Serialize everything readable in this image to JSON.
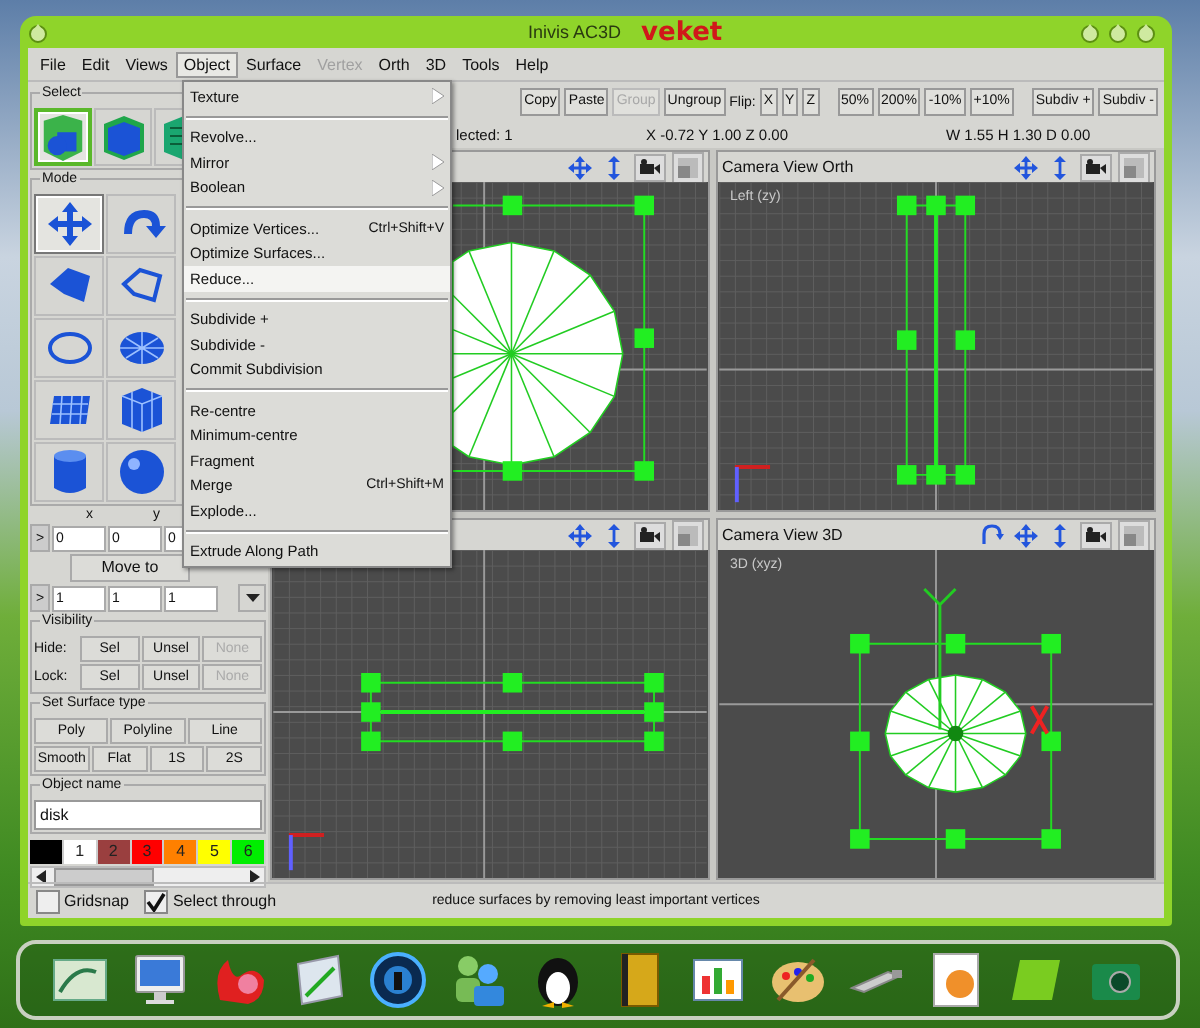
{
  "window": {
    "title": "Inivis AC3D",
    "brand": "veket"
  },
  "menu_bar": [
    {
      "label": "File",
      "selected": false,
      "disabled": false
    },
    {
      "label": "Edit",
      "selected": false,
      "disabled": false
    },
    {
      "label": "Views",
      "selected": false,
      "disabled": false
    },
    {
      "label": "Object",
      "selected": true,
      "disabled": false
    },
    {
      "label": "Surface",
      "selected": false,
      "disabled": false
    },
    {
      "label": "Vertex",
      "selected": false,
      "disabled": true
    },
    {
      "label": "Orth",
      "selected": false,
      "disabled": false
    },
    {
      "label": "3D",
      "selected": false,
      "disabled": false
    },
    {
      "label": "Tools",
      "selected": false,
      "disabled": false
    },
    {
      "label": "Help",
      "selected": false,
      "disabled": false
    }
  ],
  "object_menu": [
    {
      "kind": "item",
      "label": "Texture",
      "submenu": true,
      "selected": false
    },
    {
      "kind": "separator"
    },
    {
      "kind": "item",
      "label": "Revolve...",
      "submenu": false,
      "selected": false
    },
    {
      "kind": "item",
      "label": "Mirror",
      "submenu": true,
      "selected": false
    },
    {
      "kind": "item",
      "label": "Boolean",
      "submenu": true,
      "selected": false
    },
    {
      "kind": "separator"
    },
    {
      "kind": "item",
      "label": "Optimize Vertices...",
      "shortcut": "Ctrl+Shift+V",
      "submenu": false,
      "selected": false
    },
    {
      "kind": "item",
      "label": "Optimize Surfaces...",
      "submenu": false,
      "selected": false
    },
    {
      "kind": "item",
      "label": "Reduce...",
      "submenu": false,
      "selected": true
    },
    {
      "kind": "separator"
    },
    {
      "kind": "item",
      "label": "Subdivide +",
      "submenu": false,
      "selected": false
    },
    {
      "kind": "item",
      "label": "Subdivide -",
      "submenu": false,
      "selected": false
    },
    {
      "kind": "item",
      "label": "Commit Subdivision",
      "submenu": false,
      "selected": false
    },
    {
      "kind": "separator"
    },
    {
      "kind": "item",
      "label": "Re-centre",
      "submenu": false,
      "selected": false
    },
    {
      "kind": "item",
      "label": "Minimum-centre",
      "submenu": false,
      "selected": false
    },
    {
      "kind": "item",
      "label": "Fragment",
      "submenu": false,
      "selected": false
    },
    {
      "kind": "item",
      "label": "Merge",
      "shortcut": "Ctrl+Shift+M",
      "submenu": false,
      "selected": false
    },
    {
      "kind": "item",
      "label": "Explode...",
      "submenu": false,
      "selected": false
    },
    {
      "kind": "separator"
    },
    {
      "kind": "item",
      "label": "Extrude Along Path",
      "submenu": false,
      "selected": false
    }
  ],
  "toolbar": [
    {
      "kind": "button",
      "label": "Copy",
      "disabled": false
    },
    {
      "kind": "button",
      "label": "Paste",
      "disabled": false
    },
    {
      "kind": "button",
      "label": "Group",
      "disabled": true
    },
    {
      "kind": "button",
      "label": "Ungroup",
      "disabled": false
    },
    {
      "kind": "label",
      "label": "Flip:"
    },
    {
      "kind": "button",
      "label": "X",
      "disabled": false
    },
    {
      "kind": "button",
      "label": "Y",
      "disabled": false
    },
    {
      "kind": "button",
      "label": "Z",
      "disabled": false
    },
    {
      "kind": "gap"
    },
    {
      "kind": "button",
      "label": "50%",
      "disabled": false
    },
    {
      "kind": "button",
      "label": "200%",
      "disabled": false
    },
    {
      "kind": "button",
      "label": "-10%",
      "disabled": false
    },
    {
      "kind": "button",
      "label": "+10%",
      "disabled": false
    },
    {
      "kind": "gap"
    },
    {
      "kind": "button",
      "label": "Subdiv +",
      "disabled": false
    },
    {
      "kind": "button",
      "label": "Subdiv -",
      "disabled": false
    }
  ],
  "info": {
    "selected": "lected: 1",
    "position": "X -0.72 Y 1.00 Z 0.00",
    "dimensions": "W 1.55 H 1.30 D 0.00"
  },
  "left_panel": {
    "select": {
      "title": "Select",
      "tools": [
        {
          "kind": "objects",
          "selected": true
        },
        {
          "kind": "cube",
          "selected": false
        },
        {
          "kind": "surfaces",
          "selected": false
        }
      ]
    },
    "mode": {
      "title": "Mode",
      "tools": [
        {
          "kind": "move",
          "selected": true
        },
        {
          "kind": "rotate",
          "selected": false
        },
        {
          "kind": "polygon",
          "selected": false
        },
        {
          "kind": "polyline",
          "selected": false
        },
        {
          "kind": "circle",
          "selected": false
        },
        {
          "kind": "disk",
          "selected": false
        },
        {
          "kind": "grid",
          "selected": false
        },
        {
          "kind": "box",
          "selected": false
        },
        {
          "kind": "cylinder",
          "selected": false
        },
        {
          "kind": "sphere",
          "selected": false
        }
      ]
    },
    "axis_labels": [
      "x",
      "y"
    ],
    "position_button": ">",
    "position_fields": [
      "0",
      "0",
      "0"
    ],
    "move_button": "Move to",
    "scale_button": ">",
    "scale_fields": [
      "1",
      "1",
      "1"
    ],
    "visibility": {
      "title": "Visibility",
      "rows": [
        {
          "label": "Hide:",
          "buttons": [
            {
              "label": "Sel",
              "disabled": false
            },
            {
              "label": "Unsel",
              "disabled": false
            },
            {
              "label": "None",
              "disabled": true
            }
          ]
        },
        {
          "label": "Lock:",
          "buttons": [
            {
              "label": "Sel",
              "disabled": false
            },
            {
              "label": "Unsel",
              "disabled": false
            },
            {
              "label": "None",
              "disabled": true
            }
          ]
        }
      ]
    },
    "surface_type": {
      "title": "Set Surface type",
      "buttons": [
        "Poly",
        "Polyline",
        "Line",
        "Smooth",
        "Flat",
        "1S",
        "2S"
      ]
    },
    "object_name": {
      "title": "Object name",
      "value": "disk"
    },
    "palette": [
      {
        "color": "#000000"
      },
      {
        "label": "1",
        "color": "#ffffff"
      },
      {
        "label": "2",
        "color": "#9a3f3f"
      },
      {
        "label": "3",
        "color": "#ff0000"
      },
      {
        "label": "4",
        "color": "#ff8000"
      },
      {
        "label": "5",
        "color": "#ffff00"
      },
      {
        "label": "6",
        "color": "#00ee00"
      }
    ]
  },
  "viewports": [
    {
      "kind": "front"
    },
    {
      "kind": "side",
      "title": "Camera View Orth",
      "caption": "Left (zy)"
    },
    {
      "kind": "top"
    },
    {
      "kind": "perspective",
      "title": "Camera View 3D",
      "caption": "3D (xyz)"
    }
  ],
  "status_bar": {
    "checkboxes": [
      {
        "label": "Gridsnap",
        "checked": false
      },
      {
        "label": "Select through",
        "checked": true
      }
    ],
    "message": "reduce surfaces by removing least important vertices"
  },
  "dock": [
    {
      "kind": "picture"
    },
    {
      "kind": "monitor"
    },
    {
      "kind": "creature"
    },
    {
      "kind": "notepad"
    },
    {
      "kind": "disc"
    },
    {
      "kind": "users"
    },
    {
      "kind": "penguin"
    },
    {
      "kind": "book"
    },
    {
      "kind": "chart"
    },
    {
      "kind": "palette"
    },
    {
      "kind": "usb"
    },
    {
      "kind": "photo"
    },
    {
      "kind": "tile"
    },
    {
      "kind": "camera"
    }
  ]
}
